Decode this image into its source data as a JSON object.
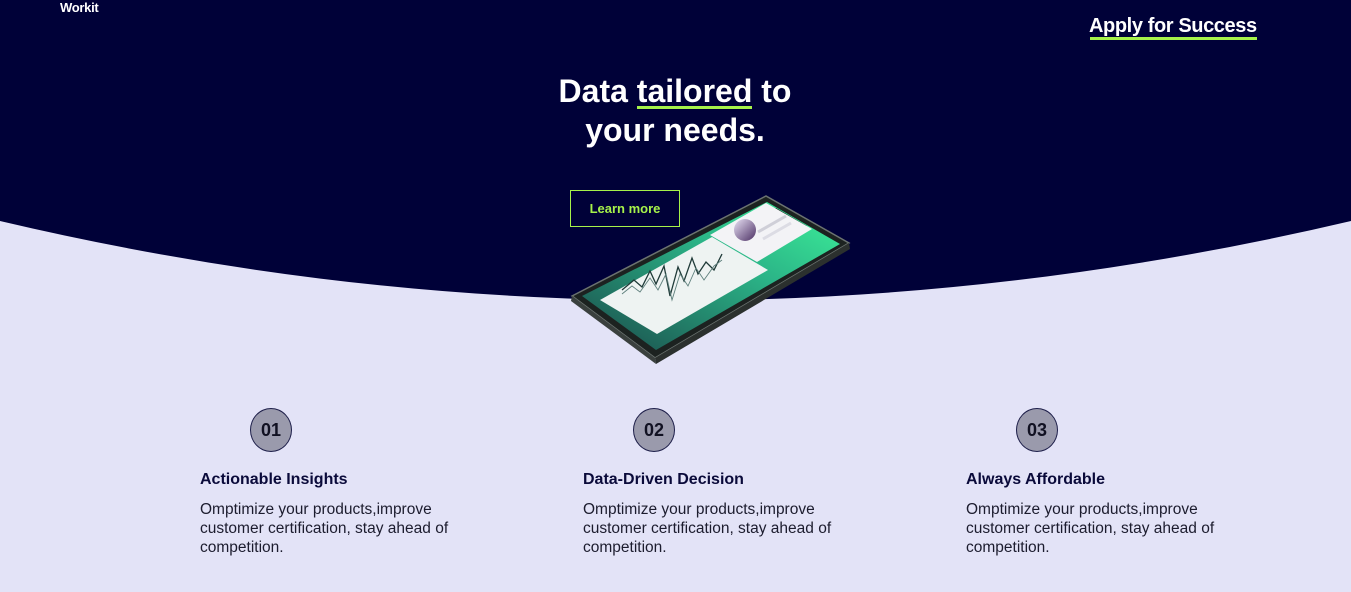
{
  "header": {
    "logo": "Workit",
    "apply_link": "Apply for Success"
  },
  "hero": {
    "headline_pre": "Data",
    "headline_highlight": "tailored",
    "headline_post": "to",
    "headline_line2": "your needs.",
    "cta_label": "Learn more"
  },
  "features": [
    {
      "number": "01",
      "title": "Actionable Insights",
      "body": "Omptimize your products,improve customer certification, stay ahead of competition."
    },
    {
      "number": "02",
      "title": "Data-Driven Decision",
      "body": "Omptimize your products,improve customer certification, stay ahead of competition."
    },
    {
      "number": "03",
      "title": "Always Affordable",
      "body": "Omptimize your products,improve customer certification, stay ahead of competition."
    }
  ],
  "colors": {
    "hero_navy": "#000138",
    "page_lavender": "#e3e3f7",
    "accent_green": "#a6f24a",
    "badge_gray": "#9a9aac"
  },
  "icons": {
    "hero_image": "smartphone-chart-illustration"
  }
}
